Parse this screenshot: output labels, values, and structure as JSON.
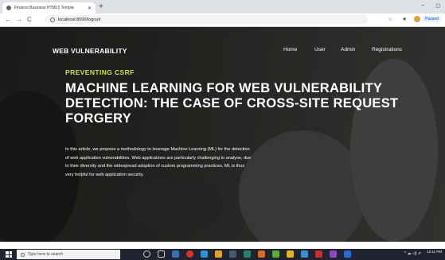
{
  "browser": {
    "tab_title": "Finance Business HTML5 Templa",
    "tab_close": "✕",
    "new_tab": "+",
    "window_controls": [
      "–",
      "◻"
    ],
    "nav": {
      "back": "←",
      "forward": "→",
      "reload": "C"
    },
    "url": "localhost:8000/logout/",
    "star": "☆",
    "extensions": "★",
    "profile_status": "Paused"
  },
  "site": {
    "brand": "WEB VULNERABILITY",
    "nav": [
      "Home",
      "User",
      "Admin",
      "Registrations"
    ]
  },
  "hero": {
    "eyebrow": "PREVENTING CSRF",
    "headline": "MACHINE LEARNING FOR WEB VULNERABILITY DETECTION: THE CASE OF CROSS-SITE REQUEST FORGERY",
    "description": "In this article, we propose a methodology to leverage Machine Learning (ML) for the detection of web application vulnerabilities. Web applications are particularly challenging to analyse, due to their diversity and the widespread adoption of custom programming practices. ML is thus very helpful for web application security."
  },
  "taskbar": {
    "search_placeholder": "Type here to search",
    "tray": "^ ☁ ◁) ⇗",
    "time": "12:11 PM",
    "date": ""
  },
  "colors": {
    "accent": "#c6e25a",
    "taskbar": "#1f2430",
    "hero_overlay": "#0f0f0f"
  }
}
